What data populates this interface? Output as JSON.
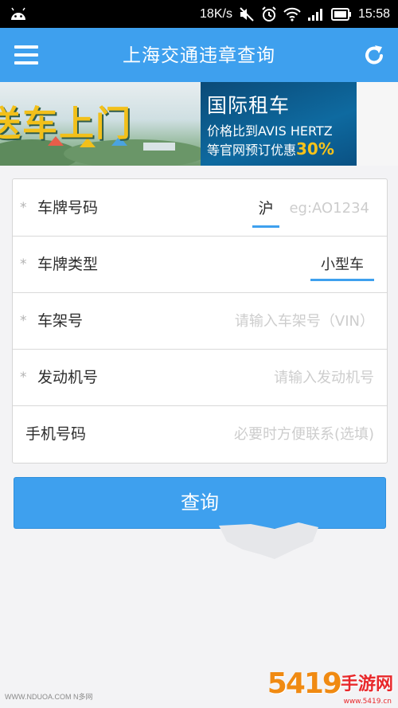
{
  "status_bar": {
    "speed": "18K/s",
    "time": "15:58",
    "icons": [
      "android-icon",
      "mute-icon",
      "alarm-icon",
      "wifi-icon",
      "signal-icon",
      "battery-icon"
    ]
  },
  "app_bar": {
    "title": "上海交通违章查询",
    "menu_icon": "menu-icon",
    "refresh_icon": "refresh-icon",
    "color": "#3ea0ee"
  },
  "banner": {
    "left_text": "送车上门",
    "right_title": "国际租车",
    "right_line1": "价格比到AVIS HERTZ",
    "right_line2": "等官网预订优惠",
    "right_percent": "30%"
  },
  "form": {
    "rows": [
      {
        "required_mark": "*",
        "label": "车牌号码",
        "province": "沪",
        "placeholder": "eg:AO1234"
      },
      {
        "required_mark": "*",
        "label": "车牌类型",
        "value": "小型车"
      },
      {
        "required_mark": "*",
        "label": "车架号",
        "placeholder": "请输入车架号（VIN）"
      },
      {
        "required_mark": "*",
        "label": "发动机号",
        "placeholder": "请输入发动机号"
      },
      {
        "label": "手机号码",
        "placeholder": "必要时方便联系(选填)"
      }
    ]
  },
  "query_button": {
    "label": "查询"
  },
  "footer": {
    "left_text": "WWW.NDUOA.COM N多网",
    "logo_number": "5419",
    "logo_text": "手游网",
    "logo_url": "www.5419.cn"
  }
}
